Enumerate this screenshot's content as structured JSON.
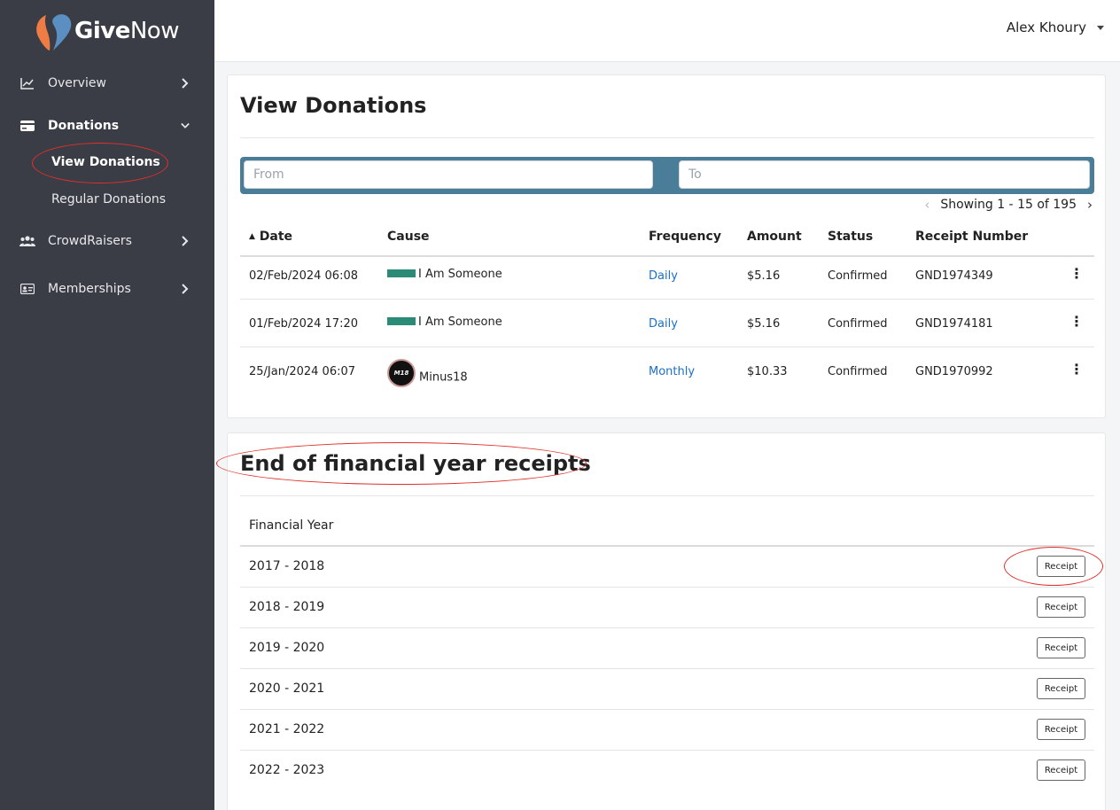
{
  "brand": {
    "name_bold": "Give",
    "name_light": "Now"
  },
  "header": {
    "user_name": "Alex Khoury"
  },
  "sidebar": {
    "items": [
      {
        "label": "Overview",
        "icon": "chart-line-icon"
      },
      {
        "label": "Donations",
        "icon": "wallet-icon",
        "expanded": true,
        "children": [
          {
            "label": "View Donations",
            "active": true
          },
          {
            "label": "Regular Donations"
          }
        ]
      },
      {
        "label": "CrowdRaisers",
        "icon": "users-icon"
      },
      {
        "label": "Memberships",
        "icon": "id-card-icon"
      }
    ]
  },
  "donations": {
    "title": "View Donations",
    "filter": {
      "from_placeholder": "From",
      "to_placeholder": "To"
    },
    "pager": {
      "text": "Showing 1 - 15 of 195"
    },
    "columns": [
      "Date",
      "Cause",
      "Frequency",
      "Amount",
      "Status",
      "Receipt Number"
    ],
    "rows": [
      {
        "date": "02/Feb/2024 06:08",
        "cause": "I Am Someone",
        "frequency": "Daily",
        "amount": "$5.16",
        "status": "Confirmed",
        "receipt": "GND1974349"
      },
      {
        "date": "01/Feb/2024 17:20",
        "cause": "I Am Someone",
        "frequency": "Daily",
        "amount": "$5.16",
        "status": "Confirmed",
        "receipt": "GND1974181"
      },
      {
        "date": "25/Jan/2024 06:07",
        "cause": "Minus18",
        "frequency": "Monthly",
        "amount": "$10.33",
        "status": "Confirmed",
        "receipt": "GND1970992"
      }
    ]
  },
  "receipts": {
    "title": "End of financial year receipts",
    "column": "Financial Year",
    "button_label": "Receipt",
    "years": [
      "2017 - 2018",
      "2018 - 2019",
      "2019 - 2020",
      "2020 - 2021",
      "2021 - 2022",
      "2022 - 2023"
    ]
  },
  "colors": {
    "sidebar": "#3a3d45",
    "filter_bar": "#4a7d97",
    "link": "#1a6fc9",
    "annotation": "#e0302a",
    "brand_orange": "#ef7b45",
    "brand_blue": "#5b8fc2"
  }
}
